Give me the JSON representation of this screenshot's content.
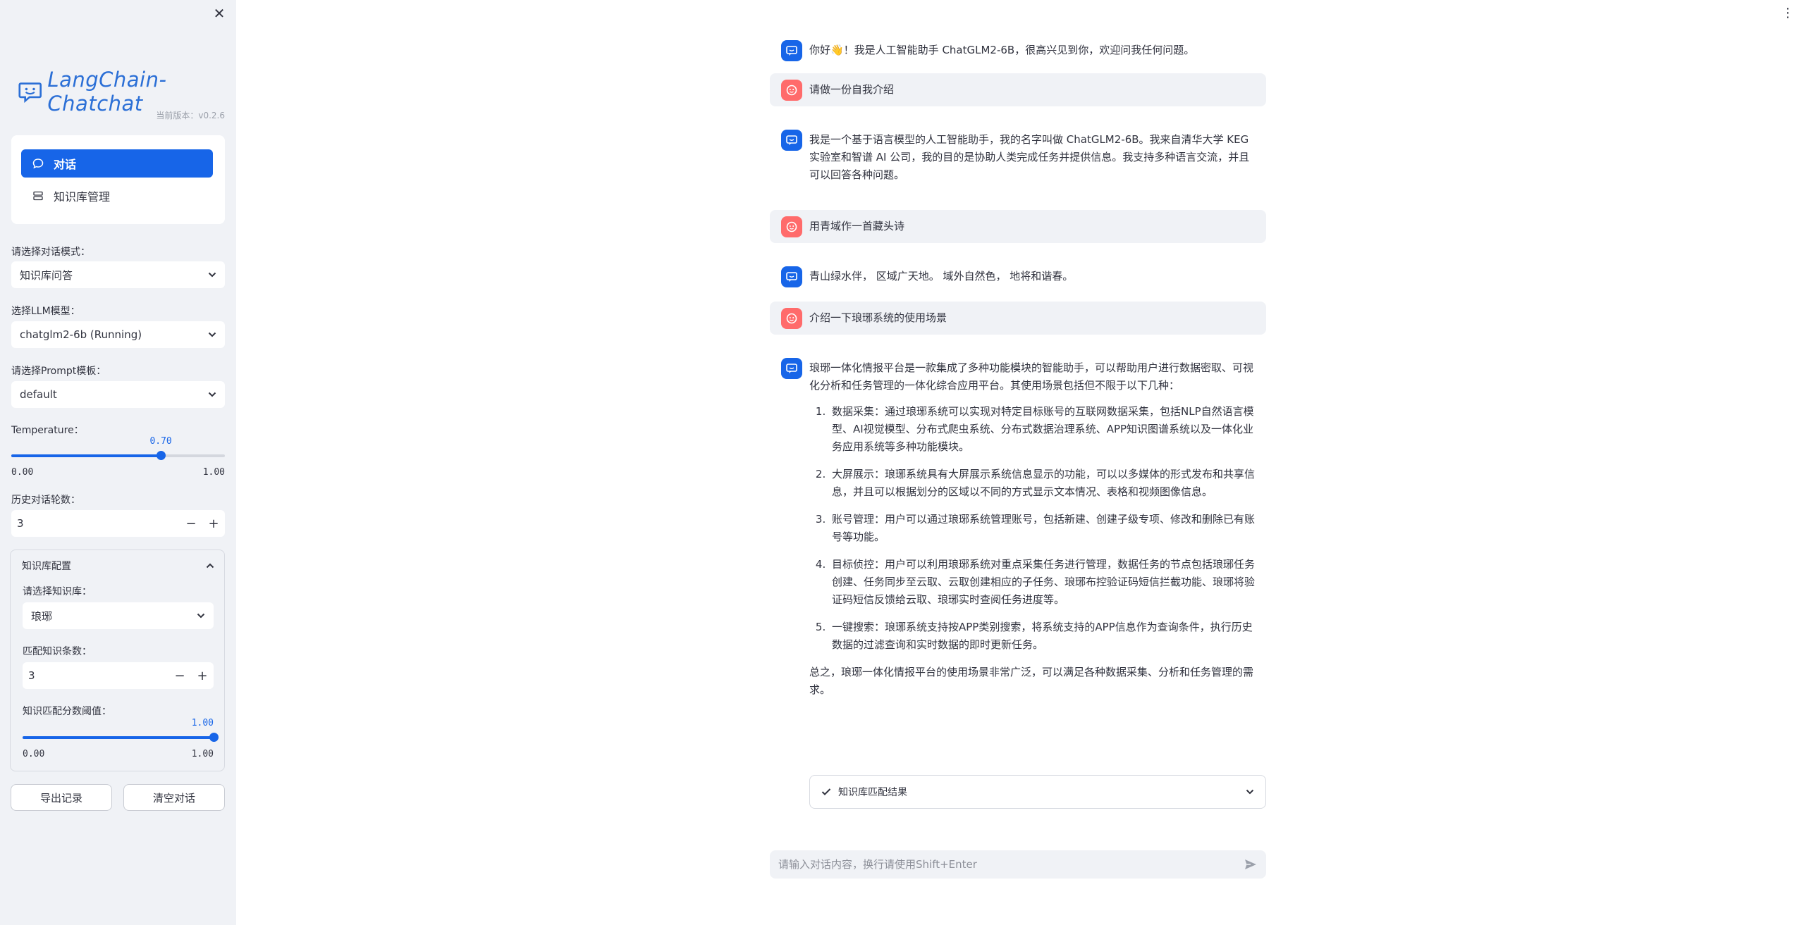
{
  "sidebar": {
    "logo_text": "LangChain-Chatchat",
    "version": "当前版本：v0.2.6",
    "nav": [
      {
        "label": "对话",
        "icon": "chat-bubble-icon",
        "active": true
      },
      {
        "label": "知识库管理",
        "icon": "database-icon",
        "active": false
      }
    ],
    "dialogue_mode": {
      "label": "请选择对话模式：",
      "value": "知识库问答"
    },
    "llm_model": {
      "label": "选择LLM模型：",
      "value": "chatglm2-6b (Running)"
    },
    "prompt_template": {
      "label": "请选择Prompt模板：",
      "value": "default"
    },
    "temperature": {
      "label": "Temperature：",
      "value": "0.70",
      "fraction": 0.7,
      "min": "0.00",
      "max": "1.00"
    },
    "history_rounds": {
      "label": "历史对话轮数：",
      "value": "3",
      "minus": "−",
      "plus": "+"
    },
    "kb_config": {
      "title": "知识库配置",
      "kb_select": {
        "label": "请选择知识库：",
        "value": "琅琊"
      },
      "match_count": {
        "label": "匹配知识条数：",
        "value": "3",
        "minus": "−",
        "plus": "+"
      },
      "score_threshold": {
        "label": "知识匹配分数阈值：",
        "value": "1.00",
        "fraction": 1.0,
        "min": "0.00",
        "max": "1.00"
      }
    },
    "export_button": "导出记录",
    "clear_button": "清空对话"
  },
  "chat": {
    "messages": [
      {
        "role": "assistant",
        "text": "你好👋！我是人工智能助手 ChatGLM2-6B，很高兴见到你，欢迎问我任何问题。"
      },
      {
        "role": "user",
        "text": "请做一份自我介绍"
      },
      {
        "role": "assistant",
        "text": "我是一个基于语言模型的人工智能助手，我的名字叫做 ChatGLM2-6B。我来自清华大学 KEG 实验室和智谱 AI 公司，我的目的是协助人类完成任务并提供信息。我支持多种语言交流，并且可以回答各种问题。"
      },
      {
        "role": "user",
        "text": "用青域作一首藏头诗"
      },
      {
        "role": "assistant",
        "text": "青山绿水伴， 区域广天地。 域外自然色， 地将和谐春。"
      },
      {
        "role": "user",
        "text": "介绍一下琅琊系统的使用场景"
      }
    ],
    "last_answer": {
      "intro": "琅琊一体化情报平台是一款集成了多种功能模块的智能助手，可以帮助用户进行数据密取、可视化分析和任务管理的一体化综合应用平台。其使用场景包括但不限于以下几种：",
      "items": [
        "数据采集：通过琅琊系统可以实现对特定目标账号的互联网数据采集，包括NLP自然语言模型、AI视觉模型、分布式爬虫系统、分布式数据治理系统、APP知识图谱系统以及一体化业务应用系统等多种功能模块。",
        "大屏展示：琅琊系统具有大屏展示系统信息显示的功能，可以以多媒体的形式发布和共享信息，并且可以根据划分的区域以不同的方式显示文本情况、表格和视频图像信息。",
        "账号管理：用户可以通过琅琊系统管理账号，包括新建、创建子级专项、修改和删除已有账号等功能。",
        "目标侦控：用户可以利用琅琊系统对重点采集任务进行管理，数据任务的节点包括琅琊任务创建、任务同步至云取、云取创建相应的子任务、琅琊布控验证码短信拦截功能、琅琊将验证码短信反馈给云取、琅琊实时查阅任务进度等。",
        "一键搜索：琅琊系统支持按APP类别搜索，将系统支持的APP信息作为查询条件，执行历史数据的过滤查询和实时数据的即时更新任务。"
      ],
      "conclusion": "总之，琅琊一体化情报平台的使用场景非常广泛，可以满足各种数据采集、分析和任务管理的需求。"
    },
    "expander_label": "知识库匹配结果",
    "input_placeholder": "请输入对话内容，换行请使用Shift+Enter"
  },
  "colors": {
    "accent": "#1765e8",
    "user_avatar": "#ff6b6b",
    "sidebar_bg": "#f0f2f6"
  }
}
